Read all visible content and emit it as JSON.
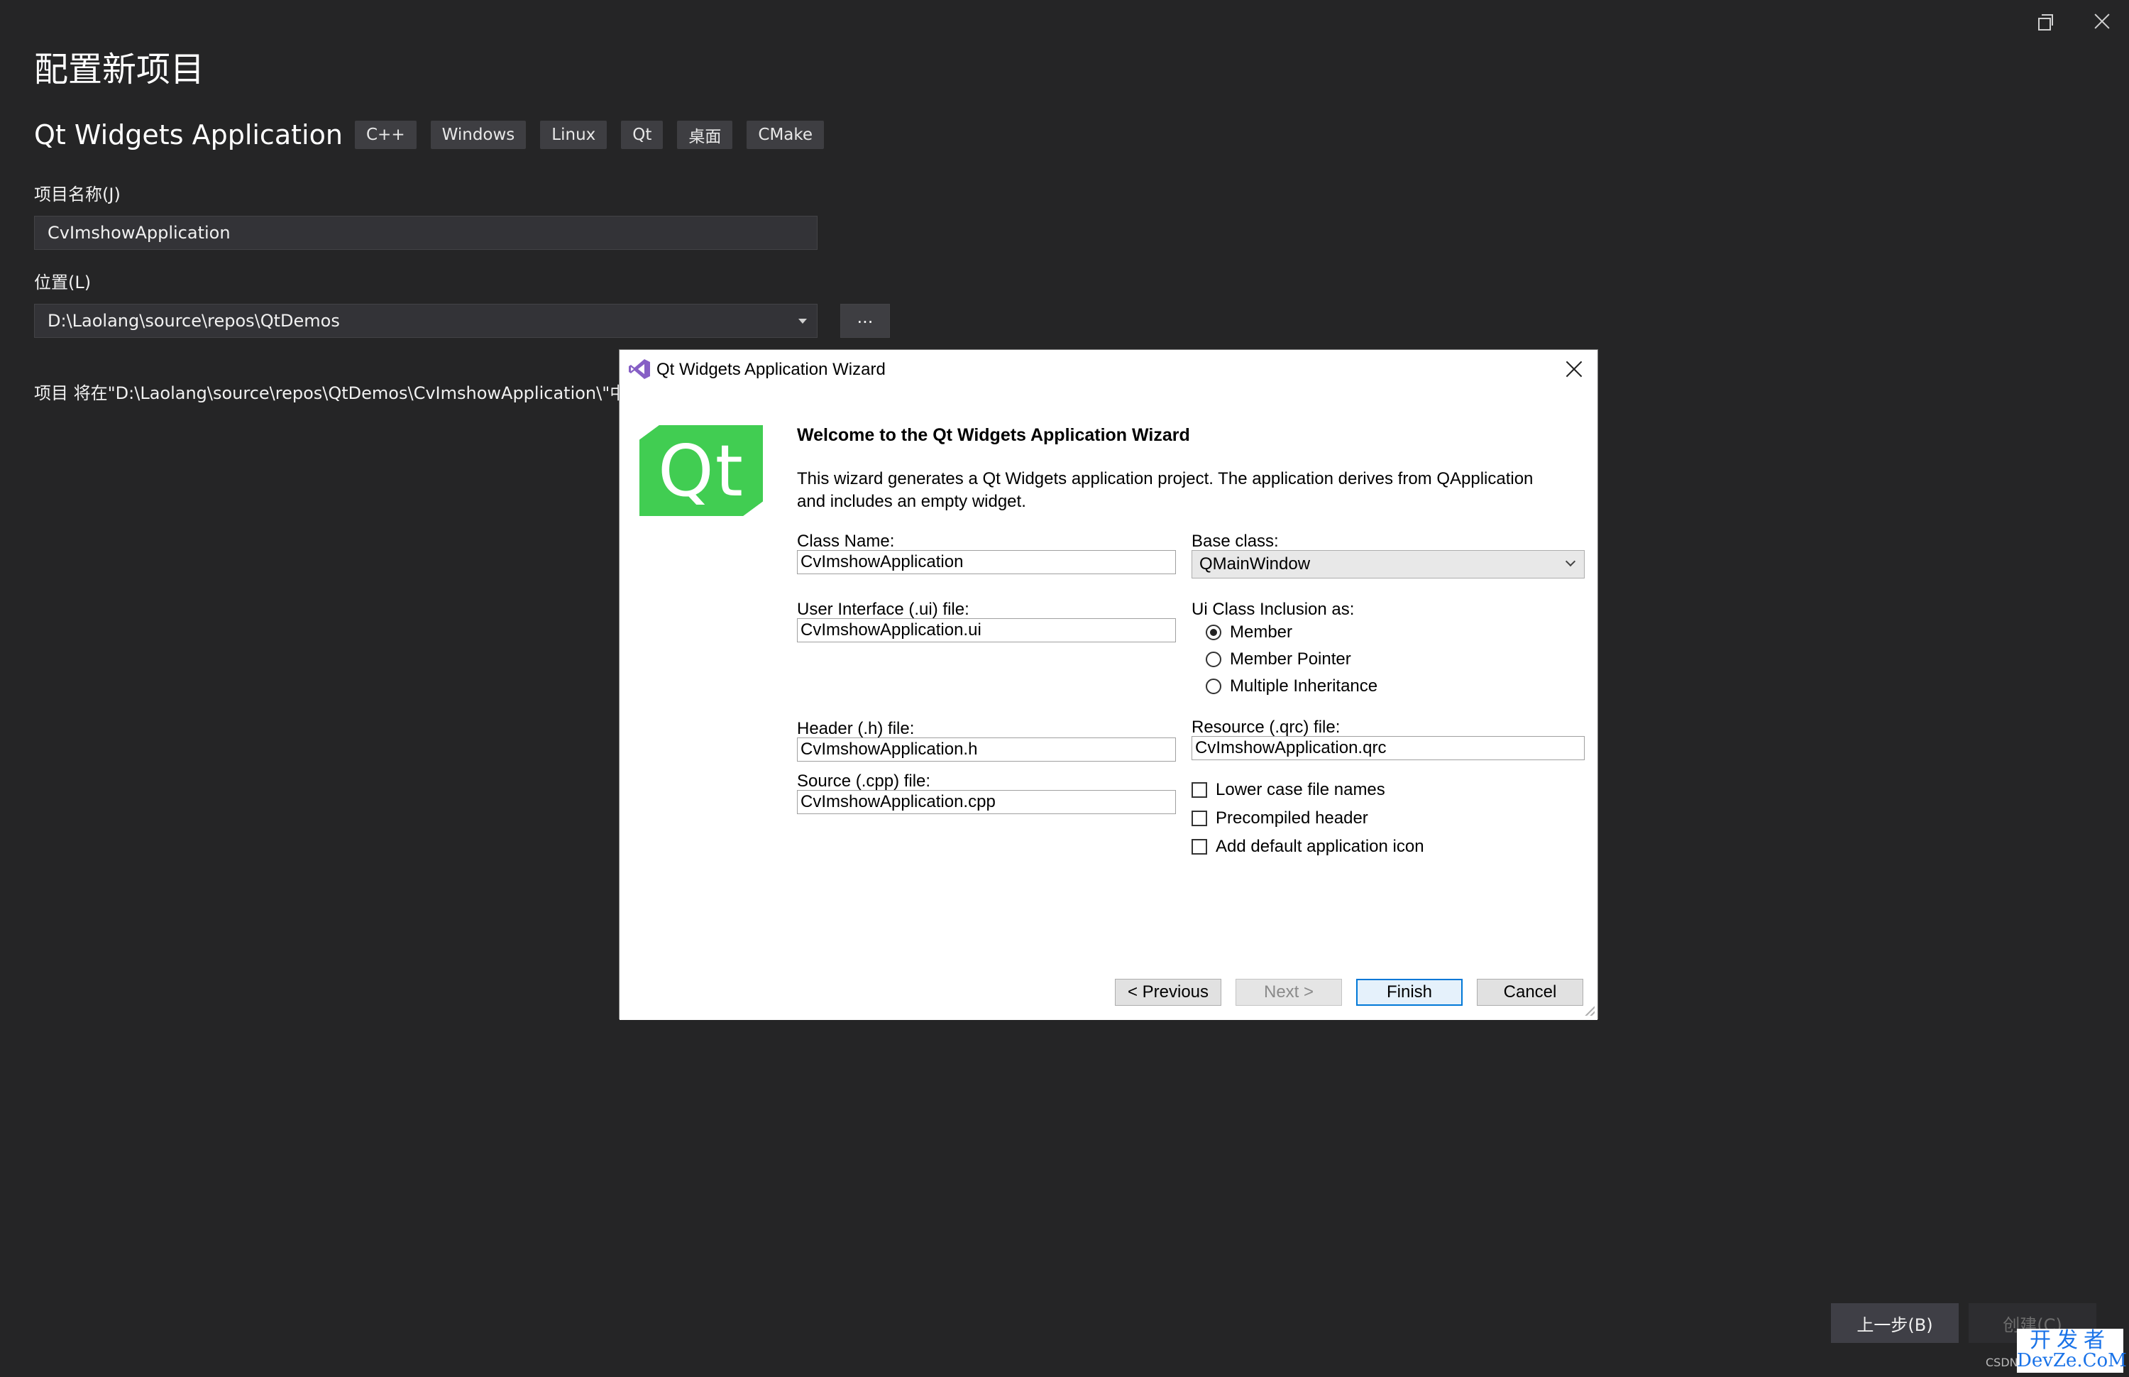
{
  "window_controls": {
    "restore": "restore-icon",
    "close": "close-icon"
  },
  "page": {
    "title": "配置新项目",
    "template_name": "Qt Widgets Application",
    "tags": [
      "C++",
      "Windows",
      "Linux",
      "Qt",
      "桌面",
      "CMake"
    ],
    "project_name_label": "项目名称(J)",
    "project_name_value": "CvImshowApplication",
    "location_label": "位置(L)",
    "location_value": "D:\\Laolang\\source\\repos\\QtDemos",
    "browse_label": "...",
    "path_note": "项目 将在\"D:\\Laolang\\source\\repos\\QtDemos\\CvImshowApplication\\\"中创建",
    "back_button": "上一步(B)",
    "create_button": "创建(C)"
  },
  "dialog": {
    "title": "Qt Widgets Application Wizard",
    "logo_text": "Qt",
    "welcome": "Welcome to the Qt Widgets Application Wizard",
    "description": "This wizard generates a Qt Widgets application project. The application derives from QApplication and includes an empty widget.",
    "class_name_label": "Class Name:",
    "class_name_value": "CvImshowApplication",
    "base_class_label": "Base class:",
    "base_class_value": "QMainWindow",
    "ui_file_label": "User Interface (.ui) file:",
    "ui_file_value": "CvImshowApplication.ui",
    "inclusion_label": "Ui Class Inclusion as:",
    "inclusion_options": [
      "Member",
      "Member Pointer",
      "Multiple Inheritance"
    ],
    "inclusion_selected": "Member",
    "header_label": "Header (.h) file:",
    "header_value": "CvImshowApplication.h",
    "resource_label": "Resource (.qrc) file:",
    "resource_value": "CvImshowApplication.qrc",
    "source_label": "Source (.cpp) file:",
    "source_value": "CvImshowApplication.cpp",
    "checkboxes": [
      "Lower case file names",
      "Precompiled header",
      "Add default application icon"
    ],
    "buttons": {
      "previous": "< Previous",
      "next": "Next >",
      "finish": "Finish",
      "cancel": "Cancel"
    }
  },
  "watermark": {
    "small": "CSDN",
    "top": "开发者",
    "bottom": "DevZe.CoM"
  },
  "colors": {
    "background": "#252526",
    "qt_green": "#41cd52",
    "accent": "#0078d7"
  }
}
